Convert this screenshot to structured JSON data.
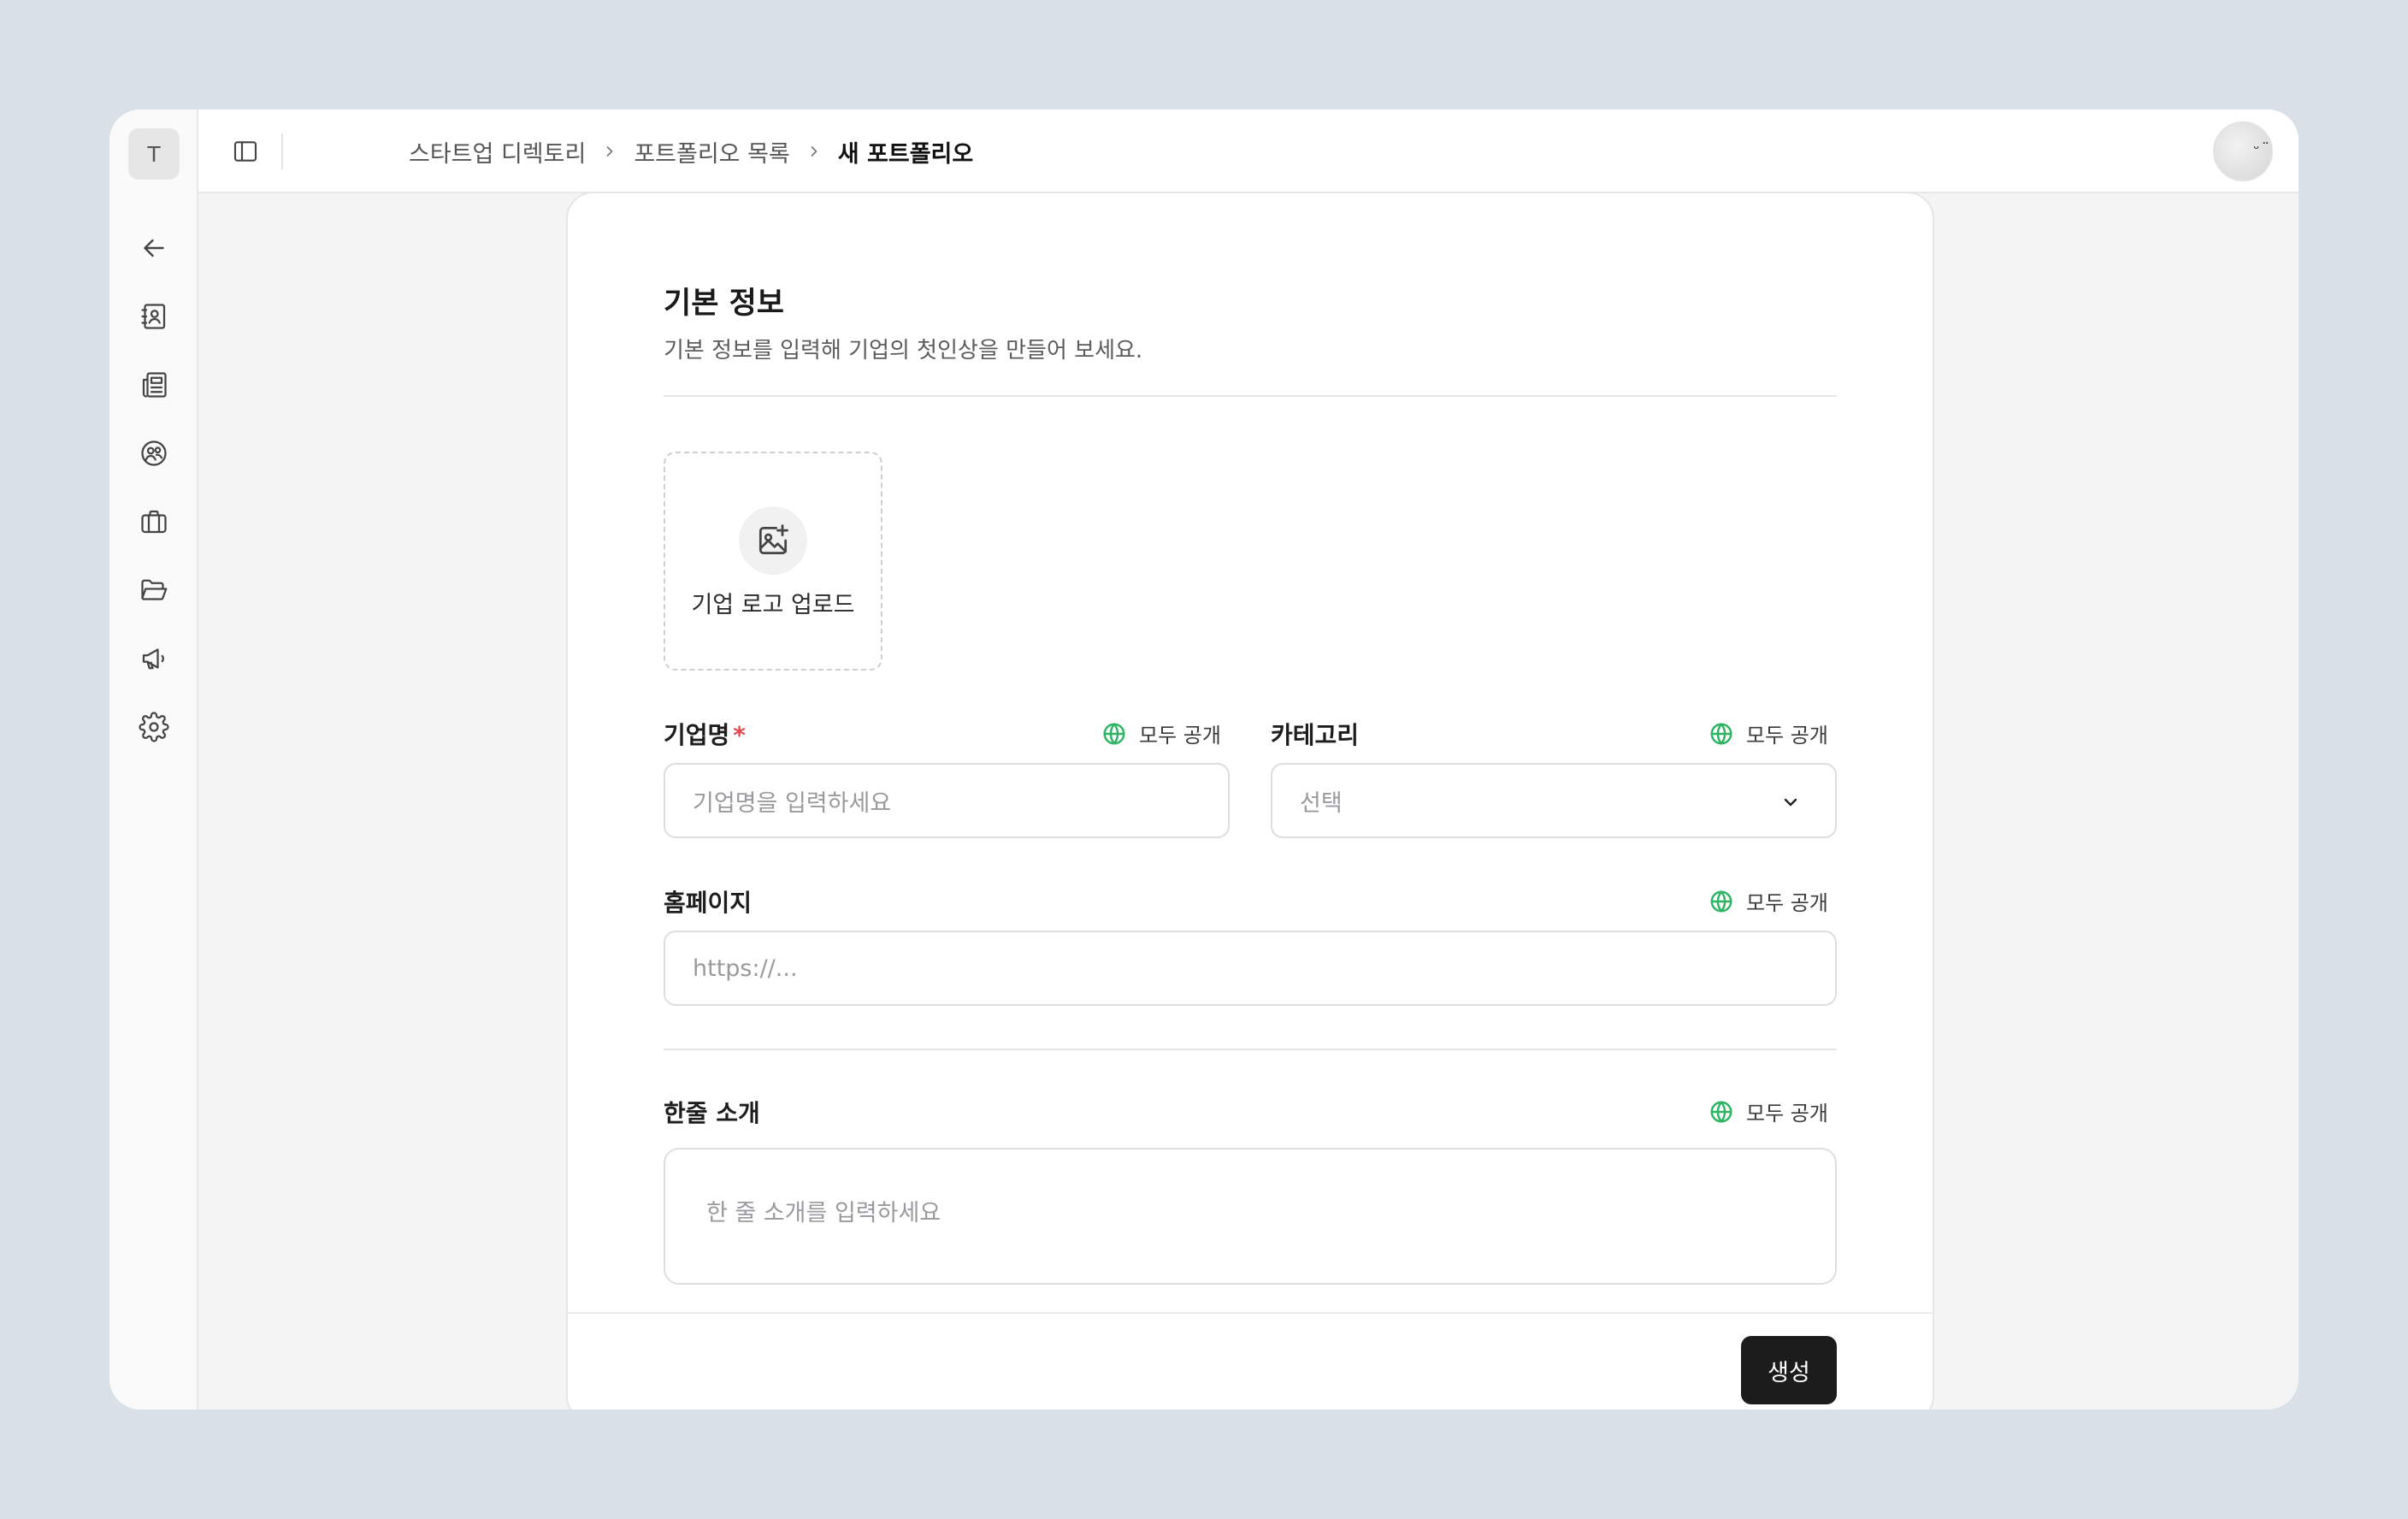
{
  "sidebar": {
    "workspace_initial": "T",
    "items": [
      {
        "name": "back",
        "icon": "arrow-left-icon"
      },
      {
        "name": "contacts",
        "icon": "contact-book-icon"
      },
      {
        "name": "news",
        "icon": "newspaper-icon"
      },
      {
        "name": "community",
        "icon": "users-circle-icon"
      },
      {
        "name": "jobs",
        "icon": "briefcase-icon"
      },
      {
        "name": "portfolio",
        "icon": "folder-open-icon"
      },
      {
        "name": "announcements",
        "icon": "megaphone-icon"
      },
      {
        "name": "settings",
        "icon": "gear-icon"
      }
    ]
  },
  "header": {
    "breadcrumb": [
      "스타트업 디렉토리",
      "포트폴리오 목록",
      "새 포트폴리오"
    ],
    "avatar_face": "ᵕ̈"
  },
  "form": {
    "section_title": "기본 정보",
    "section_desc": "기본 정보를 입력해 기업의 첫인상을 만들어 보세요.",
    "logo_upload_label": "기업 로고 업로드",
    "visibility_label": "모두 공개",
    "company_name": {
      "label": "기업명",
      "required_mark": "*",
      "placeholder": "기업명을 입력하세요"
    },
    "category": {
      "label": "카테고리",
      "value": "선택"
    },
    "homepage": {
      "label": "홈페이지",
      "placeholder": "https://..."
    },
    "tagline": {
      "label": "한줄 소개",
      "placeholder": "한 줄 소개를 입력하세요"
    },
    "submit_label": "생성"
  },
  "colors": {
    "background": "#d9e0e7",
    "accent_green": "#2fb463",
    "required_red": "#e5484d",
    "button_dark": "#1c1c1c"
  }
}
